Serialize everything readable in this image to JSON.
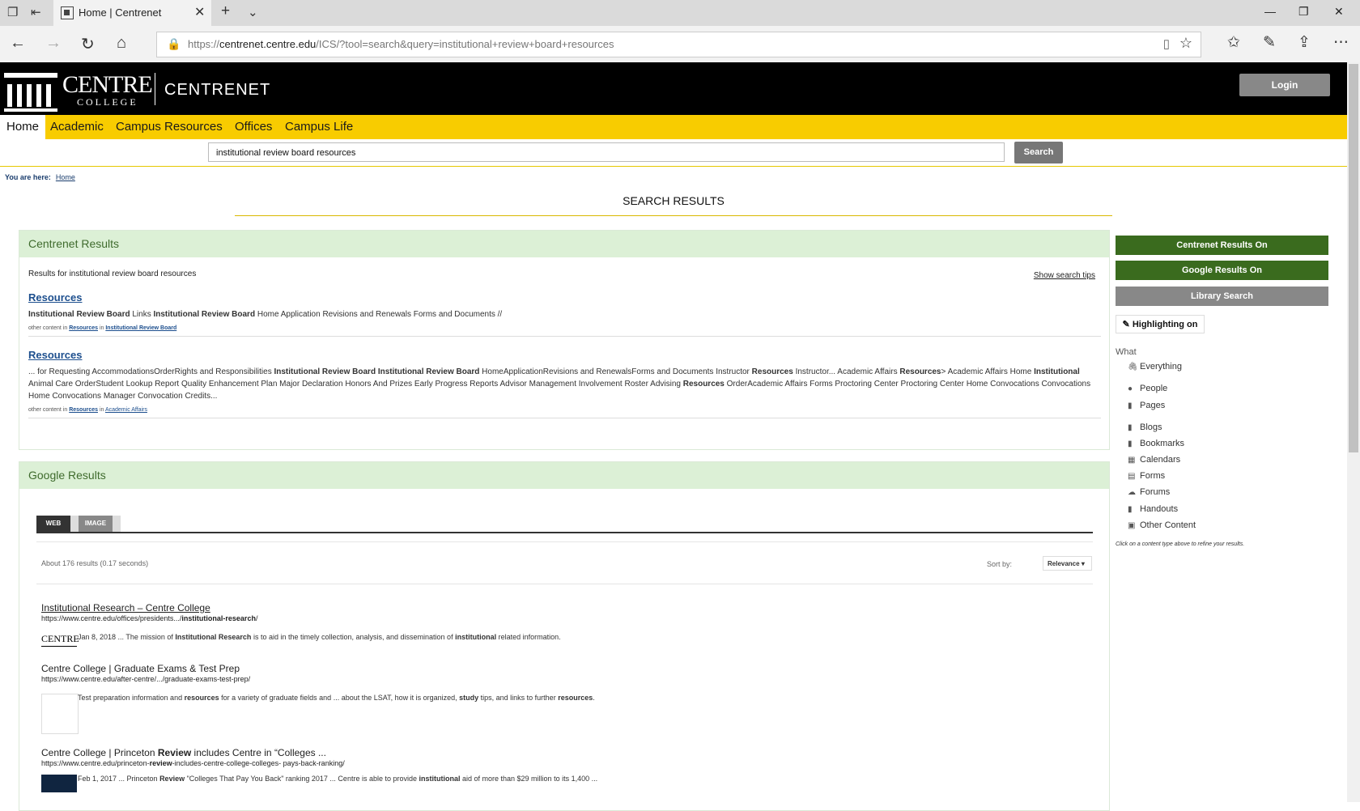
{
  "browser": {
    "tab_title": "Home | Centrenet",
    "url_prefix": "https://",
    "url_host": "centrenet.centre.edu",
    "url_rest": "/ICS/?tool=search&query=institutional+review+board+resources"
  },
  "header": {
    "logo_word1": "CENTRE",
    "logo_word2": "COLLEGE",
    "brand": "CENTRENET",
    "login": "Login"
  },
  "nav": [
    "Home",
    "Academic",
    "Campus Resources",
    "Offices",
    "Campus Life"
  ],
  "search": {
    "value": "institutional review board resources",
    "button": "Search"
  },
  "breadcrumb": {
    "prefix": "You are here:",
    "link": "Home"
  },
  "page_title": "SEARCH RESULTS",
  "centrenet": {
    "heading": "Centrenet Results",
    "results_for": "Results for institutional review board resources",
    "tips": "Show search tips",
    "results": [
      {
        "title": "Resources",
        "snippet_html": "<b>Institutional Review Board</b> Links <b>Institutional Review Board</b> Home Application Revisions and Renewals Forms and Documents //",
        "meta_html": "other content in <a>Resources</a> in <a>Institutional Review Board</a>"
      },
      {
        "title": "Resources",
        "snippet_html": "... for Requesting AccommodationsOrderRights and Responsibilities <b>Institutional Review Board Institutional Review Board</b> HomeApplicationRevisions and RenewalsForms and Documents Instructor <b>Resources</b> Instructor... Academic Affairs <b>Resources</b>&gt; Academic Affairs Home <b>Institutional</b> Animal Care OrderStudent Lookup Report Quality Enhancement Plan Major Declaration Honors And Prizes Early Progress Reports Advisor Management Involvement Roster Advising <b>Resources</b> OrderAcademic Affairs Forms Proctoring Center Proctoring Center Home Convocations Convocations Home Convocations Manager Convocation Credits...",
        "meta_html": "other content in <a>Resources</a> in <a class=\"plain\">Academic Affairs</a>"
      }
    ]
  },
  "google": {
    "heading": "Google Results",
    "tab_web": "WEB",
    "tab_image": "IMAGE",
    "count": "About 176 results (0.17 seconds)",
    "sort_label": "Sort by:",
    "sort_value": "Relevance",
    "results": [
      {
        "title": "Institutional Research – Centre College",
        "url_html": "https://www.centre.edu/offices/presidents.../<b>institutional-research</b>/",
        "desc_html": "Jan 8, 2018 ... The mission of <b>Institutional Research</b> is to aid in the timely collection, analysis, and dissemination of <b>institutional</b> related information.",
        "thumb": "CENTRE"
      },
      {
        "title": "Centre College | Graduate Exams & Test Prep",
        "url_html": "https://www.centre.edu/after-centre/.../graduate-exams-test-prep/",
        "desc_html": "Test preparation information and <b>resources</b> for a variety of graduate fields and ... about the LSAT, how it is organized, <b>study</b> tips, and links to further <b>resources</b>."
      },
      {
        "title_html": "Centre College | Princeton <b>Review</b> includes Centre in “Colleges ...",
        "url_html": "https://www.centre.edu/princeton-<b>review</b>-includes-centre-college-colleges- pays-back-ranking/",
        "desc_html": "Feb 1, 2017 ... Princeton <b>Review</b> \"Colleges That Pay You Back\" ranking 2017 ... Centre is able to provide <b>institutional</b> aid of more than $29 million to its 1,400 ..."
      }
    ]
  },
  "sidebar": {
    "btn_centrenet": "Centrenet Results On",
    "btn_google": "Google Results On",
    "btn_library": "Library Search",
    "highlighting": "Highlighting on",
    "what_label": "What",
    "content_types": [
      "Everything",
      "People",
      "Pages",
      "Blogs",
      "Bookmarks",
      "Calendars",
      "Forms",
      "Forums",
      "Handouts",
      "Other Content"
    ],
    "hint": "Click on a content type above to refine your results."
  }
}
